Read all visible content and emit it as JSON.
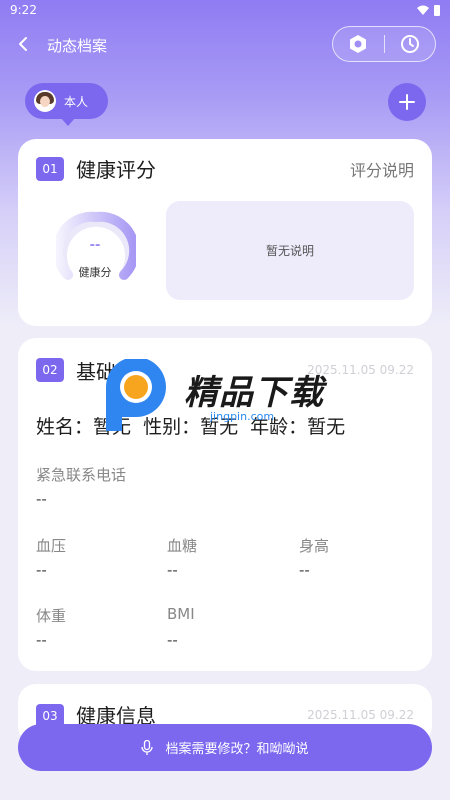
{
  "status": {
    "time": "9:22"
  },
  "nav": {
    "title": "动态档案"
  },
  "person": {
    "label": "本人"
  },
  "card1": {
    "num": "01",
    "title": "健康评分",
    "link": "评分说明",
    "score_value": "--",
    "score_label": "健康分",
    "explain": "暂无说明"
  },
  "card2": {
    "num": "02",
    "title": "基础档案",
    "time": "2025.11.05 09.22",
    "name_label": "姓名：",
    "name_value": "暂无",
    "gender_label": "性别：",
    "gender_value": "暂无",
    "age_label": "年龄：",
    "age_value": "暂无",
    "emergency_label": "紧急联系电话",
    "emergency_value": "--",
    "bp_label": "血压",
    "bp_value": "--",
    "sugar_label": "血糖",
    "sugar_value": "--",
    "height_label": "身高",
    "height_value": "--",
    "weight_label": "体重",
    "weight_value": "--",
    "bmi_label": "BMI",
    "bmi_value": "--"
  },
  "card3": {
    "num": "03",
    "title": "健康信息",
    "time": "2025.11.05 09.22"
  },
  "watermark": {
    "text": "精品下载",
    "sub": "jingpin.com"
  },
  "voice": {
    "label": "档案需要修改？和呦呦说"
  },
  "colors": {
    "accent": "#7c67ef",
    "gauge": "#9a8df0"
  }
}
